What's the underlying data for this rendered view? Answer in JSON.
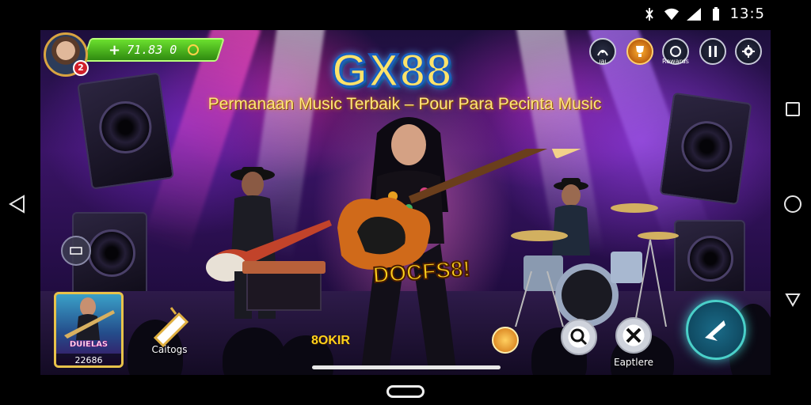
{
  "status_bar": {
    "time": "13:5",
    "icons": [
      "vibrate-icon",
      "wifi-icon",
      "signal-icon",
      "battery-icon"
    ]
  },
  "system_nav": {
    "recents": "square-icon",
    "home": "circle-icon",
    "back": "back-triangle-icon"
  },
  "hud": {
    "level": "2",
    "balance_plus": "+",
    "balance": "71.83 0",
    "top_right": [
      {
        "name": "mission-icon",
        "label": "ıaı"
      },
      {
        "name": "trophy-icon",
        "label": ""
      },
      {
        "name": "profile-menu-icon",
        "label": "Rewards"
      },
      {
        "name": "pause-icon",
        "label": ""
      },
      {
        "name": "settings-icon",
        "label": ""
      }
    ]
  },
  "banner": {
    "title": "GX88",
    "subtitle": "Permanaan Music Terbaik  – Pour Para Pecinta Music"
  },
  "stage": {
    "promo_text": "DOCFS8!",
    "center_code": "8OKIR"
  },
  "bottom": {
    "card": {
      "name": "DUIELAS",
      "value": "22686"
    },
    "catalog_label": "Caitogs",
    "search_icon": "search-icon",
    "explore_label": "Eaptlere",
    "coin_icon": "hand-coin-icon",
    "action_icon": "play-arrow-icon"
  },
  "colors": {
    "accent_green": "#6be02e",
    "title_gold": "#ffe36a",
    "title_outline": "#1a5fbf",
    "action_teal": "#4ad0c9"
  }
}
